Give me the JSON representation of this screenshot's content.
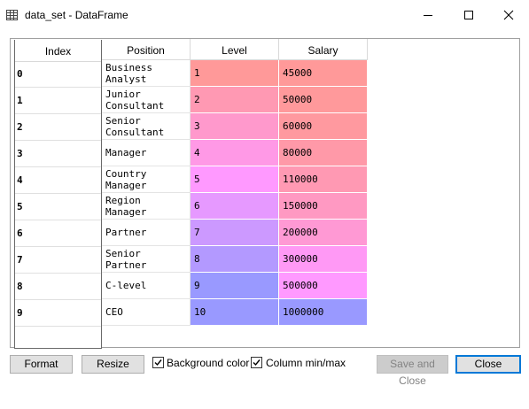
{
  "window": {
    "title": "data_set - DataFrame",
    "icon": "table-icon",
    "controls": [
      "minimize-icon",
      "maximize-icon",
      "close-icon"
    ]
  },
  "table": {
    "index_header": "Index",
    "columns": [
      "Position",
      "Level",
      "Salary"
    ],
    "rows": [
      {
        "index": "0",
        "position": [
          "Business",
          "Analyst"
        ],
        "level": "1",
        "salary": "45000",
        "level_color": "#ff9999",
        "salary_color": "#ff9999"
      },
      {
        "index": "1",
        "position": [
          "Junior",
          "Consultant"
        ],
        "level": "2",
        "salary": "50000",
        "level_color": "#ff99b3",
        "salary_color": "#ff999b"
      },
      {
        "index": "2",
        "position": [
          "Senior",
          "Consultant"
        ],
        "level": "3",
        "salary": "60000",
        "level_color": "#ff99cc",
        "salary_color": "#ff999f"
      },
      {
        "index": "3",
        "position": [
          "Manager"
        ],
        "level": "4",
        "salary": "80000",
        "level_color": "#ff99e6",
        "salary_color": "#ff99a8"
      },
      {
        "index": "4",
        "position": [
          "Country",
          "Manager"
        ],
        "level": "5",
        "salary": "110000",
        "level_color": "#ff99ff",
        "salary_color": "#ff99b3"
      },
      {
        "index": "5",
        "position": [
          "Region",
          "Manager"
        ],
        "level": "6",
        "salary": "150000",
        "level_color": "#e699ff",
        "salary_color": "#ff99c2"
      },
      {
        "index": "6",
        "position": [
          "Partner"
        ],
        "level": "7",
        "salary": "200000",
        "level_color": "#cc99ff",
        "salary_color": "#ff99d4"
      },
      {
        "index": "7",
        "position": [
          "Senior",
          "Partner"
        ],
        "level": "8",
        "salary": "300000",
        "level_color": "#b399ff",
        "salary_color": "#ff99f5"
      },
      {
        "index": "8",
        "position": [
          "C-level"
        ],
        "level": "9",
        "salary": "500000",
        "level_color": "#9999ff",
        "salary_color": "#ff99ff"
      },
      {
        "index": "9",
        "position": [
          "CEO"
        ],
        "level": "10",
        "salary": "1000000",
        "level_color": "#9999ff",
        "salary_color": "#9999ff"
      }
    ]
  },
  "buttons": {
    "format": "Format",
    "resize": "Resize",
    "save_and_close": "Save and Close",
    "close": "Close"
  },
  "checkboxes": {
    "background_color": {
      "label": "Background color",
      "checked": true
    },
    "column_minmax": {
      "label": "Column min/max",
      "checked": true
    }
  },
  "colors": {
    "default_button_border": "#0078d7"
  }
}
